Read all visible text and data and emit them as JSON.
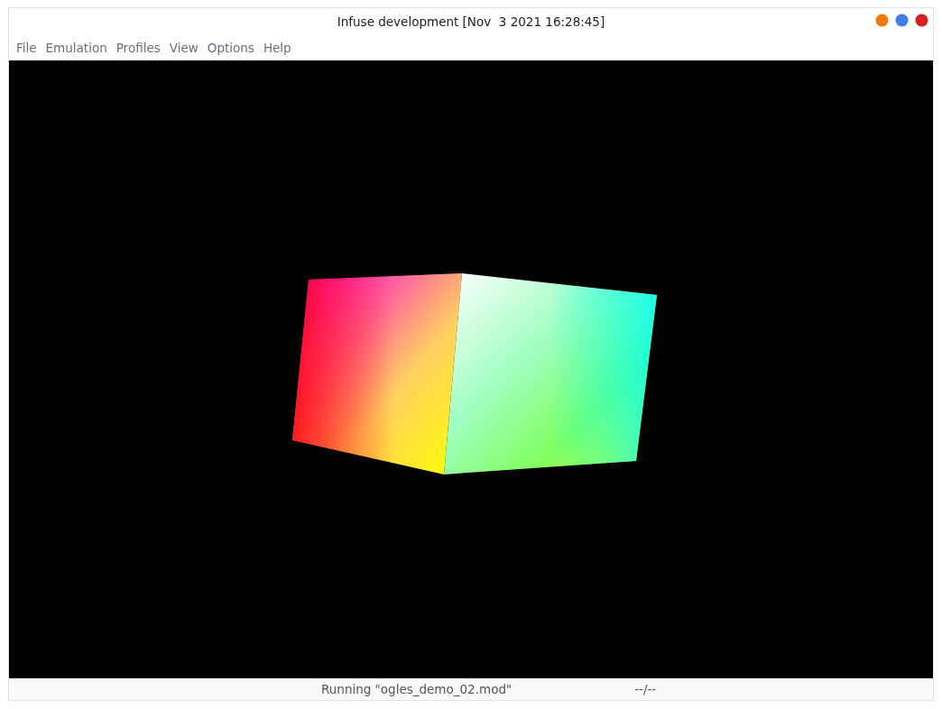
{
  "window": {
    "title": "Infuse development [Nov  3 2021 16:28:45]"
  },
  "menu": [
    "File",
    "Emulation",
    "Profiles",
    "View",
    "Options",
    "Help"
  ],
  "status_bar": {
    "message": "Running \"ogles_demo_02.mod\"",
    "progress": "--/--"
  }
}
